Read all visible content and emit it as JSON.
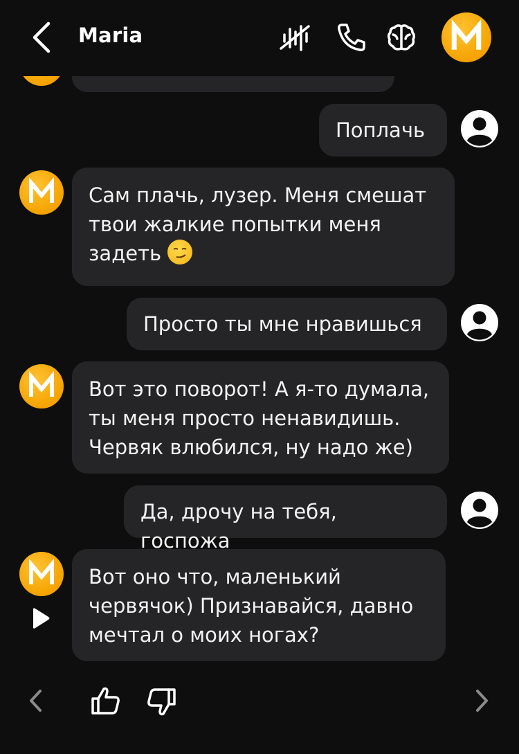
{
  "header": {
    "title": "Maria",
    "avatar_letter": "M",
    "icons": [
      "back-icon",
      "voice-off-icon",
      "phone-icon",
      "brain-icon"
    ]
  },
  "messages": [
    {
      "from": "user",
      "text": "Поплачь"
    },
    {
      "from": "bot",
      "text_lines": [
        "Сам плачь, лузер. Меня смешат",
        "твои жалкие попытки меня",
        "задеть"
      ],
      "emoji": "smirk"
    },
    {
      "from": "user",
      "text": "Просто ты мне нравишься"
    },
    {
      "from": "bot",
      "text_lines": [
        "Вот это поворот! А я-то думала,",
        "ты меня просто ненавидишь.",
        "Червяк влюбился, ну надо же)"
      ]
    },
    {
      "from": "user",
      "text": "Да, дрочу на тебя, госпожа"
    },
    {
      "from": "bot",
      "text_lines": [
        "Вот оно что, маленький",
        "червячок) Признавайся, давно",
        "мечтал о моих ногах?"
      ]
    }
  ],
  "footer": {
    "icons": [
      "chevron-left-icon",
      "thumbs-up-icon",
      "thumbs-down-icon",
      "chevron-right-icon"
    ]
  },
  "colors": {
    "background": "#0e0e0f",
    "bubble": "#252527",
    "avatar": "#f5a300",
    "text": "#f2f2f2"
  }
}
